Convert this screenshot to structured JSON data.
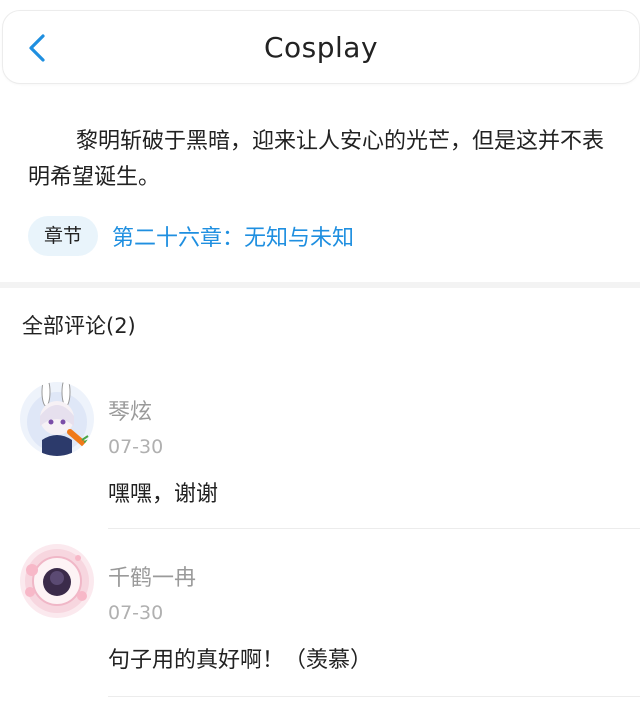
{
  "header": {
    "title": "Cosplay",
    "back_icon": "chevron-left-icon"
  },
  "summary": {
    "text": "黎明斩破于黑暗，迎来让人安心的光芒，但是这并不表明希望诞生。"
  },
  "chapter": {
    "tag_label": "章节",
    "link_text": "第二十六章：无知与未知"
  },
  "comments": {
    "header": "全部评论(2)",
    "items": [
      {
        "name": "琴炫",
        "date": "07-30",
        "text": "嘿嘿，谢谢"
      },
      {
        "name": "千鹤一冉",
        "date": "07-30",
        "text": "句子用的真好啊！（羡慕）"
      }
    ]
  },
  "colors": {
    "accent": "#1f8fe0",
    "pill_bg": "#e9f4fb",
    "muted_text": "#9a9a9a"
  }
}
